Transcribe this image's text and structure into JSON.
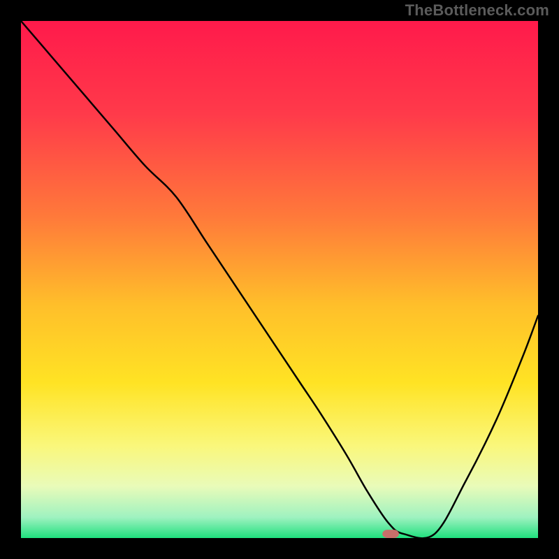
{
  "watermark": "TheBottleneck.com",
  "chart_data": {
    "type": "line",
    "title": "",
    "xlabel": "",
    "ylabel": "",
    "xlim": [
      0,
      100
    ],
    "ylim": [
      0,
      100
    ],
    "background_gradient_stops": [
      {
        "offset": 0,
        "color": "#ff1a4b"
      },
      {
        "offset": 18,
        "color": "#ff3a4a"
      },
      {
        "offset": 38,
        "color": "#ff7a3a"
      },
      {
        "offset": 55,
        "color": "#ffbf2a"
      },
      {
        "offset": 70,
        "color": "#ffe324"
      },
      {
        "offset": 82,
        "color": "#faf77a"
      },
      {
        "offset": 90,
        "color": "#e9fbb9"
      },
      {
        "offset": 96,
        "color": "#9ff2c0"
      },
      {
        "offset": 100,
        "color": "#1fe07e"
      }
    ],
    "series": [
      {
        "name": "bottleneck-curve",
        "color": "#000000",
        "stroke_width": 2.5,
        "x": [
          0,
          6,
          12,
          18,
          24,
          30,
          36,
          42,
          48,
          54,
          58,
          63,
          67,
          71,
          74,
          80,
          86,
          92,
          97,
          100
        ],
        "y": [
          100,
          93,
          86,
          79,
          72,
          66,
          57,
          48,
          39,
          30,
          24,
          16,
          9,
          3,
          0.8,
          0.8,
          11,
          23,
          35,
          43
        ]
      }
    ],
    "marker": {
      "name": "selected-point",
      "x": 71.5,
      "y": 0.8,
      "width": 3.2,
      "height": 1.6,
      "rx": 1.0,
      "color": "#c76f6a"
    }
  }
}
